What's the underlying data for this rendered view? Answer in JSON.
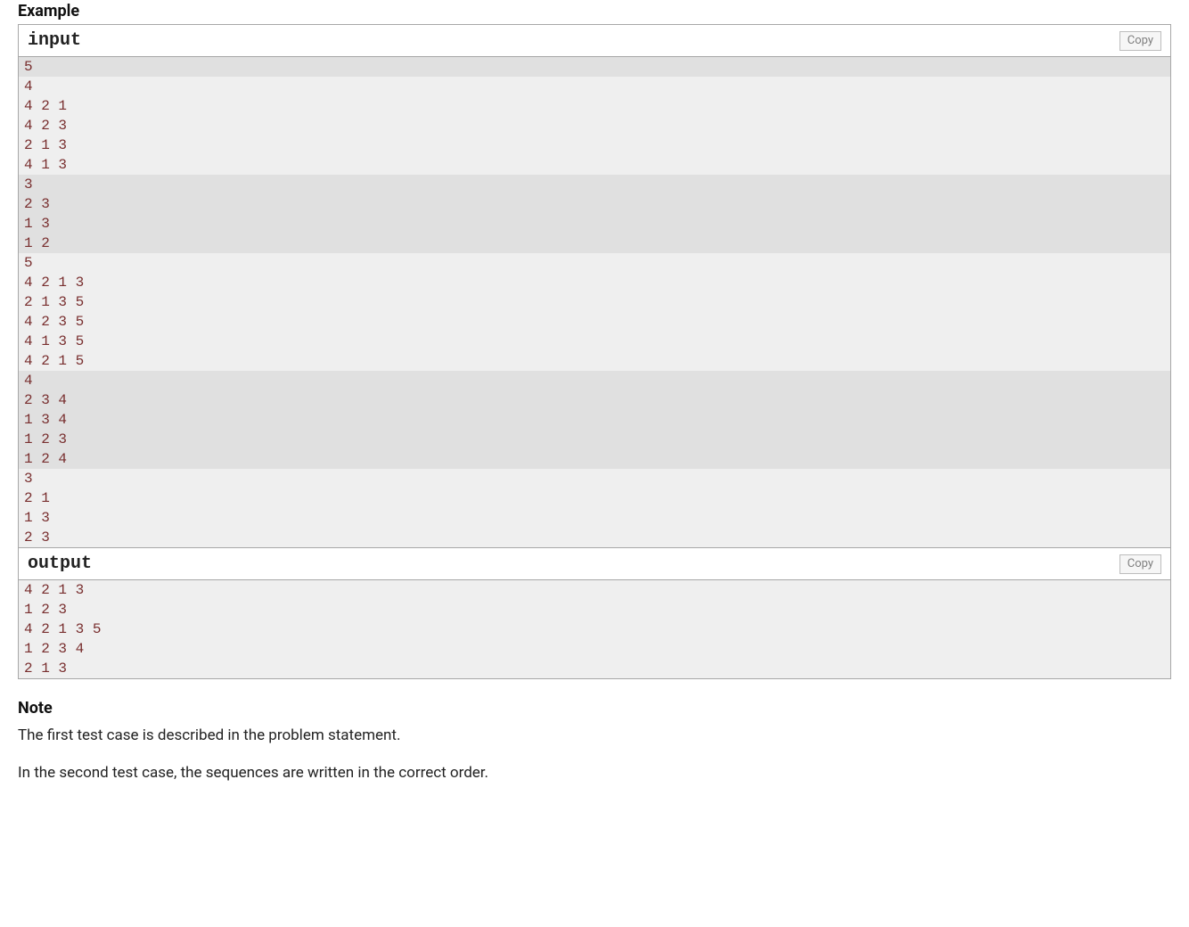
{
  "headings": {
    "example": "Example",
    "note": "Note"
  },
  "copy_label": "Copy",
  "input_label": "input",
  "output_label": "output",
  "input_lines": [
    {
      "t": "5",
      "s": true
    },
    {
      "t": "4",
      "s": false
    },
    {
      "t": "4 2 1",
      "s": false
    },
    {
      "t": "4 2 3",
      "s": false
    },
    {
      "t": "2 1 3",
      "s": false
    },
    {
      "t": "4 1 3",
      "s": false
    },
    {
      "t": "3",
      "s": true
    },
    {
      "t": "2 3",
      "s": true
    },
    {
      "t": "1 3",
      "s": true
    },
    {
      "t": "1 2",
      "s": true
    },
    {
      "t": "5",
      "s": false
    },
    {
      "t": "4 2 1 3",
      "s": false
    },
    {
      "t": "2 1 3 5",
      "s": false
    },
    {
      "t": "4 2 3 5",
      "s": false
    },
    {
      "t": "4 1 3 5",
      "s": false
    },
    {
      "t": "4 2 1 5",
      "s": false
    },
    {
      "t": "4",
      "s": true
    },
    {
      "t": "2 3 4",
      "s": true
    },
    {
      "t": "1 3 4",
      "s": true
    },
    {
      "t": "1 2 3",
      "s": true
    },
    {
      "t": "1 2 4",
      "s": true
    },
    {
      "t": "3",
      "s": false
    },
    {
      "t": "2 1",
      "s": false
    },
    {
      "t": "1 3",
      "s": false
    },
    {
      "t": "2 3",
      "s": false
    }
  ],
  "output_lines": [
    {
      "t": "4 2 1 3",
      "s": false
    },
    {
      "t": "1 2 3",
      "s": false
    },
    {
      "t": "4 2 1 3 5",
      "s": false
    },
    {
      "t": "1 2 3 4",
      "s": false
    },
    {
      "t": "2 1 3",
      "s": false
    }
  ],
  "note_paragraphs": [
    "The first test case is described in the problem statement.",
    "In the second test case, the sequences are written in the correct order."
  ]
}
